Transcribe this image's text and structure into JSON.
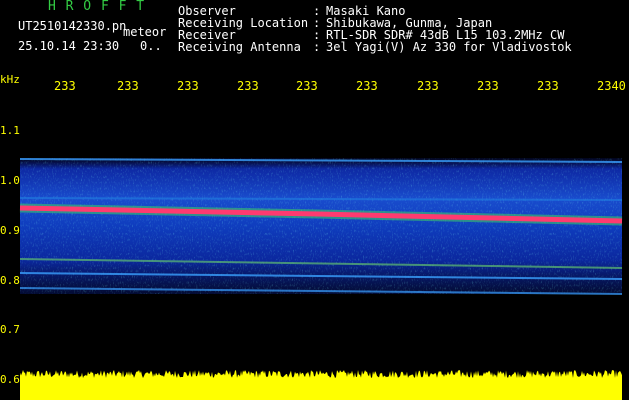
{
  "header": {
    "app_title": "H R O F F T",
    "filename": "UT2510142330.pn",
    "meteor_label": "meteor",
    "datetime": "25.10.14 23:30",
    "count": "0.."
  },
  "info": [
    {
      "label": "Observer",
      "value": "Masaki Kano"
    },
    {
      "label": "Receiving Location",
      "value": "Shibukawa, Gunma, Japan"
    },
    {
      "label": "Receiver",
      "value": "RTL-SDR SDR# 43dB L15 103.2MHz CW"
    },
    {
      "label": "Receiving Antenna",
      "value": "3el Yagi(V) Az 330 for Vladivostok"
    }
  ],
  "time_ticks": [
    "233",
    "233",
    "233",
    "233",
    "233",
    "233",
    "233",
    "233",
    "233",
    "2340"
  ],
  "freq_axis": {
    "unit": "kHz",
    "labels": [
      "1.1",
      "1.0",
      "0.9",
      "0.8",
      "0.7",
      "0.6"
    ]
  },
  "colors": {
    "title_green": "#33cc44",
    "axis_yellow": "#ffff00",
    "text_white": "#ffffff",
    "background": "#000000",
    "trace_pink": "#ff3a70",
    "noise_yellow": "#ffff00"
  }
}
